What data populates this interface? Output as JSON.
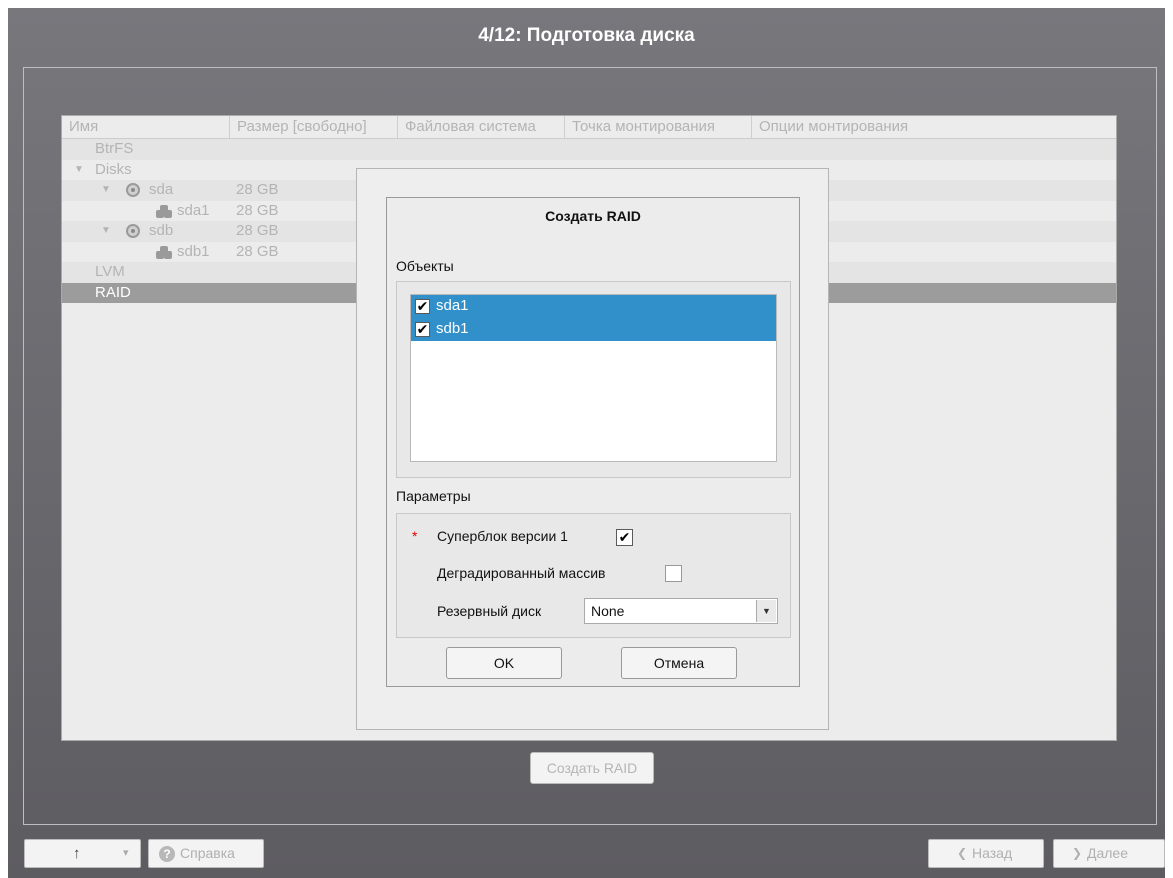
{
  "title": "4/12: Подготовка диска",
  "tree": {
    "columns": [
      "Имя",
      "Размер [свободно]",
      "Файловая система",
      "Точка монтирования",
      "Опции монтирования"
    ],
    "rows": [
      {
        "name": "BtrFS",
        "size": ""
      },
      {
        "name": "Disks",
        "size": ""
      },
      {
        "name": "sda",
        "size": "28 GB"
      },
      {
        "name": "sda1",
        "size": "28 GB"
      },
      {
        "name": "sdb",
        "size": "28 GB"
      },
      {
        "name": "sdb1",
        "size": "28 GB"
      },
      {
        "name": "LVM",
        "size": ""
      },
      {
        "name": "RAID",
        "size": ""
      }
    ]
  },
  "create_raid_button": "Создать RAID",
  "footer": {
    "up_arrow": "↑",
    "dropdown_arrow": "▾",
    "help_label": "Справка",
    "back_label": "Назад",
    "next_label": "Далее"
  },
  "dialog": {
    "title": "Создать RAID",
    "objects_label": "Объекты",
    "objects": [
      {
        "label": "sda1",
        "checked": true
      },
      {
        "label": "sdb1",
        "checked": true
      }
    ],
    "params_label": "Параметры",
    "required_mark": "*",
    "superblock_label": "Суперблок версии 1",
    "superblock_checked": true,
    "degraded_label": "Деградированный массив",
    "degraded_checked": false,
    "spare_label": "Резервный диск",
    "spare_value": "None",
    "ok_label": "OK",
    "cancel_label": "Отмена"
  },
  "colors": {
    "background_top": "#77777c",
    "background_bottom": "#5d5c61",
    "selection": "#3190c9",
    "tree_selected": "#9c9c9c"
  }
}
